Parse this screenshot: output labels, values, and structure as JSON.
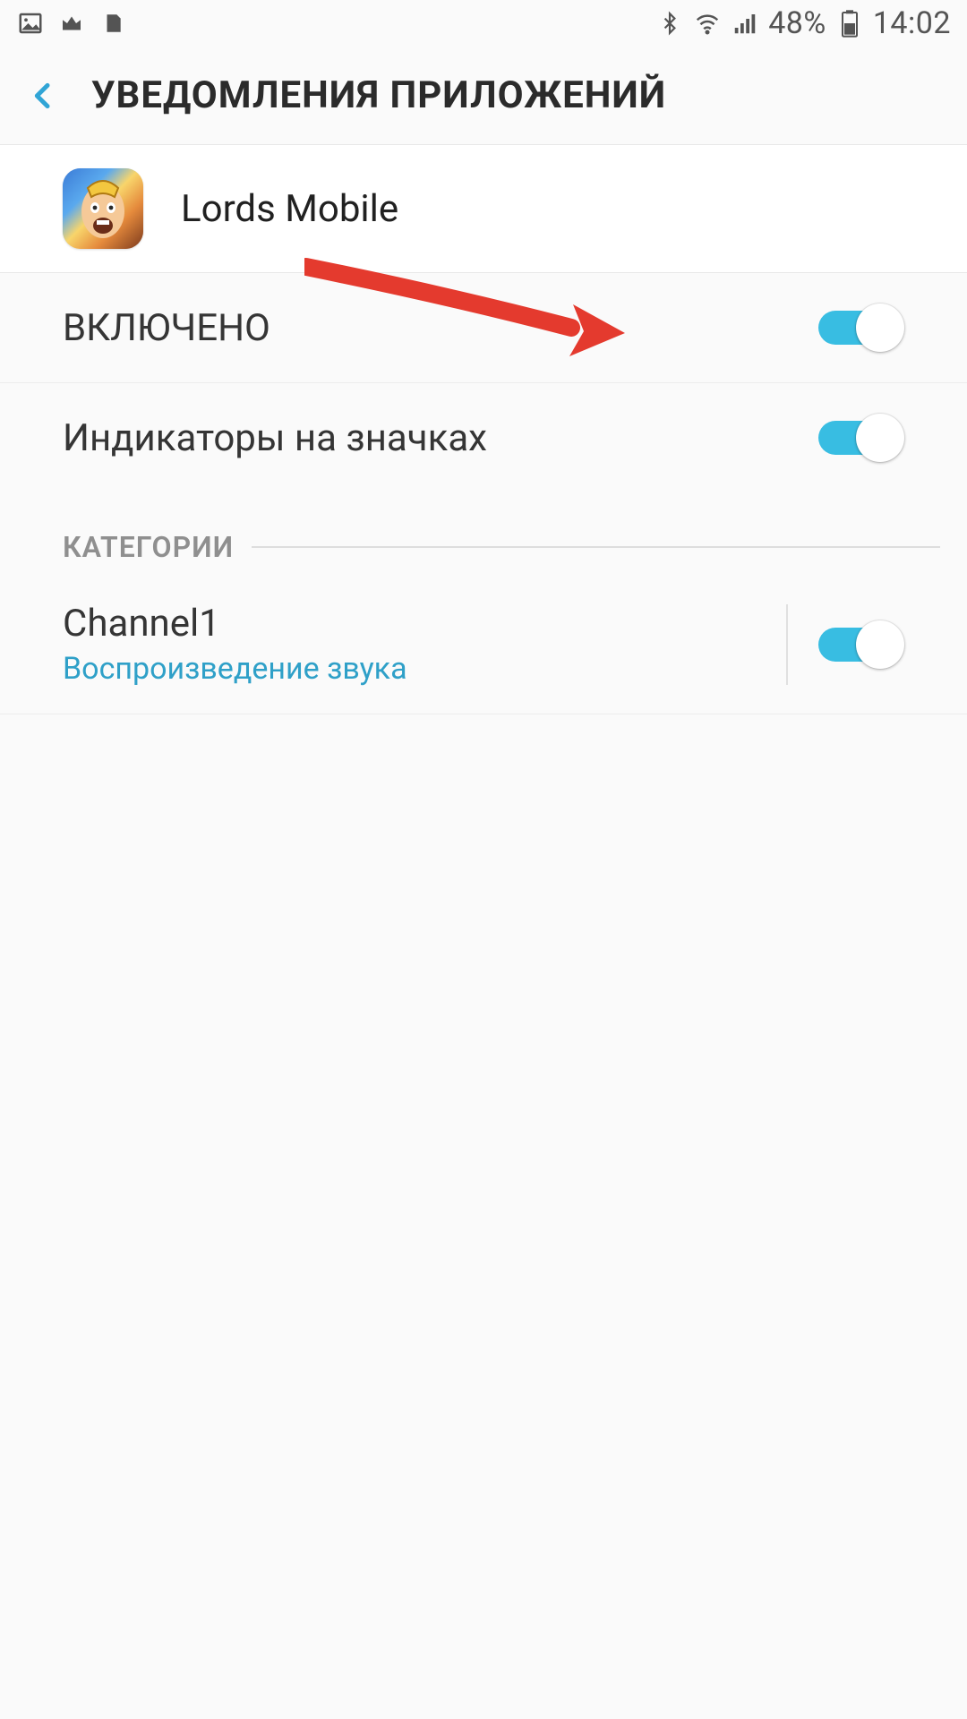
{
  "status": {
    "battery_text": "48%",
    "time": "14:02"
  },
  "header": {
    "title": "УВЕДОМЛЕНИЯ ПРИЛОЖЕНИЙ"
  },
  "app": {
    "name": "Lords Mobile"
  },
  "rows": {
    "enabled_label": "ВКЛЮЧЕНО",
    "badges_label": "Индикаторы на значках"
  },
  "section": {
    "categories": "КАТЕГОРИИ"
  },
  "channel": {
    "name": "Channel1",
    "subtitle": "Воспроизведение звука"
  },
  "colors": {
    "accent": "#38bde2",
    "link": "#2fa0c8"
  }
}
